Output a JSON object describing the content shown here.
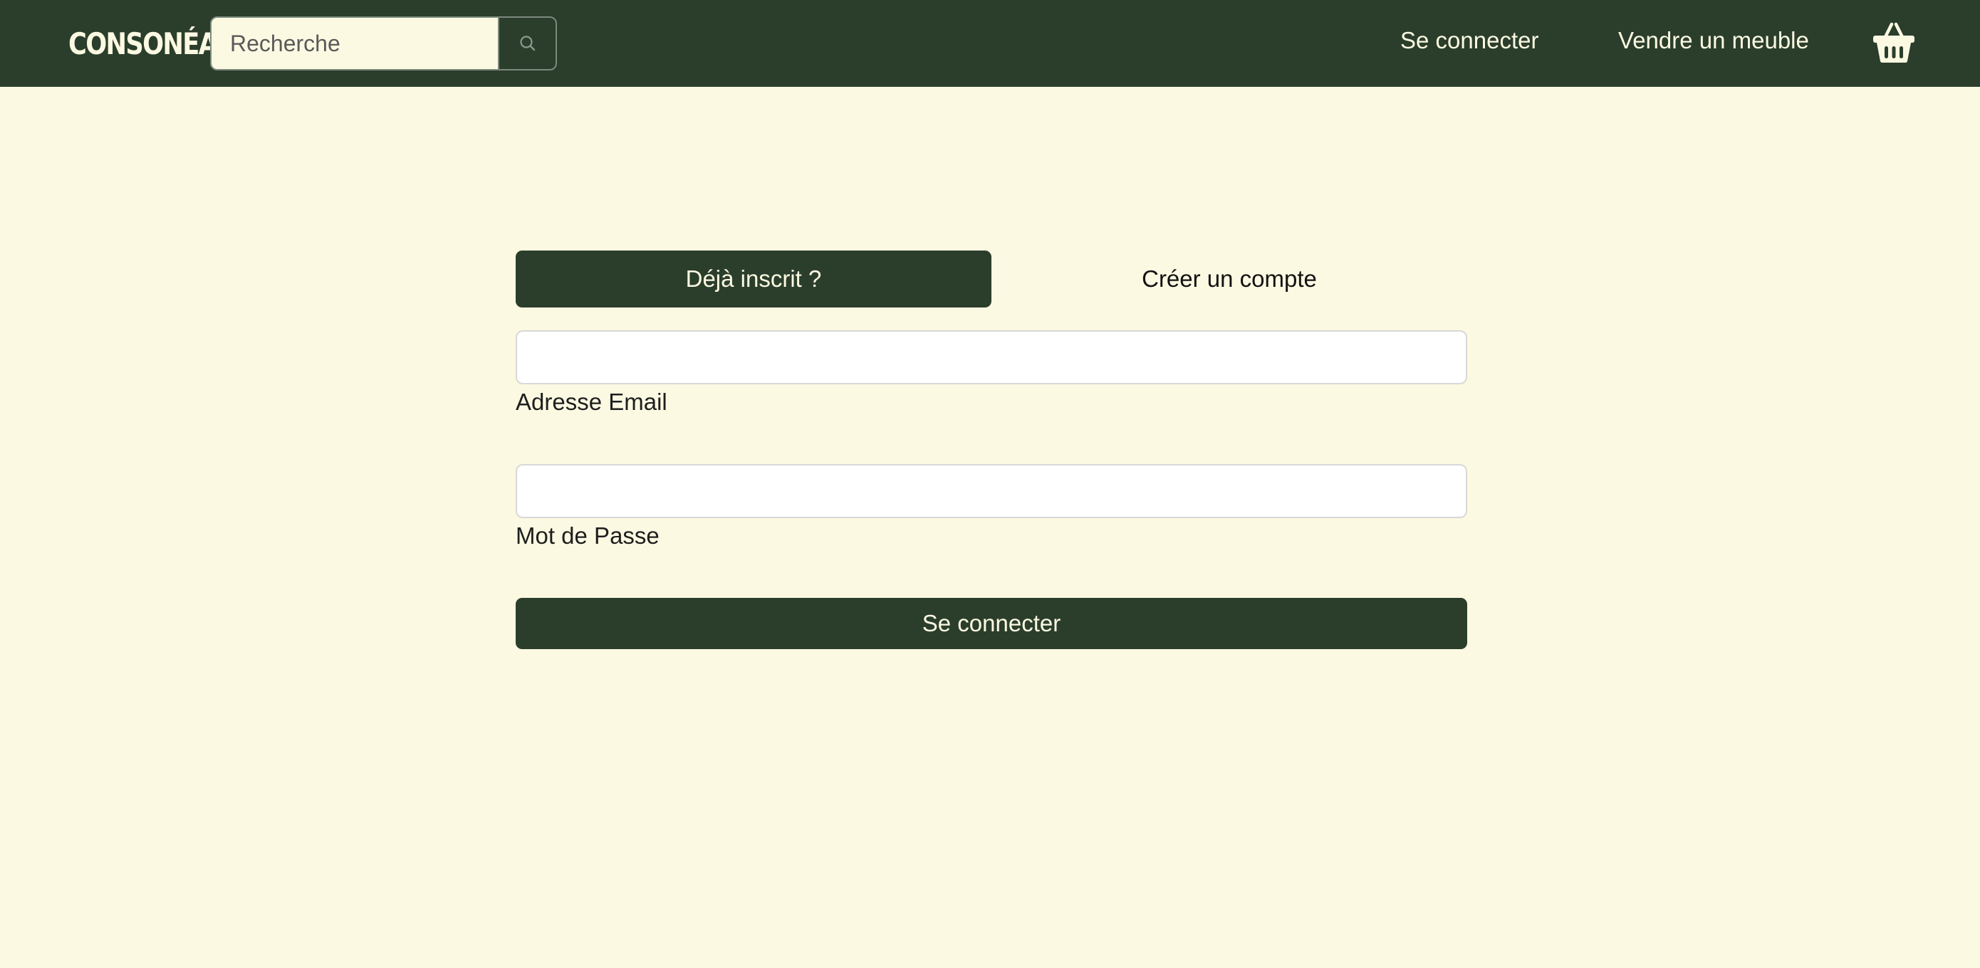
{
  "header": {
    "brand": "CONSONÉA",
    "search": {
      "placeholder": "Recherche",
      "value": "",
      "button_icon": "search-icon"
    },
    "nav": {
      "login_label": "Se connecter",
      "sell_label": "Vendre un meuble",
      "cart_icon": "basket-icon"
    }
  },
  "auth": {
    "tabs": [
      {
        "label": "Déjà inscrit ?",
        "active": true
      },
      {
        "label": "Créer un compte",
        "active": false
      }
    ],
    "fields": {
      "email": {
        "label": "Adresse Email",
        "value": ""
      },
      "password": {
        "label": "Mot de Passe",
        "value": ""
      }
    },
    "submit_label": "Se connecter"
  },
  "colors": {
    "primary": "#2b3e2c",
    "background": "#fcf9e2",
    "on_primary": "#fcf9e2",
    "field_background": "#ffffff",
    "field_border": "#d8d8d8"
  }
}
